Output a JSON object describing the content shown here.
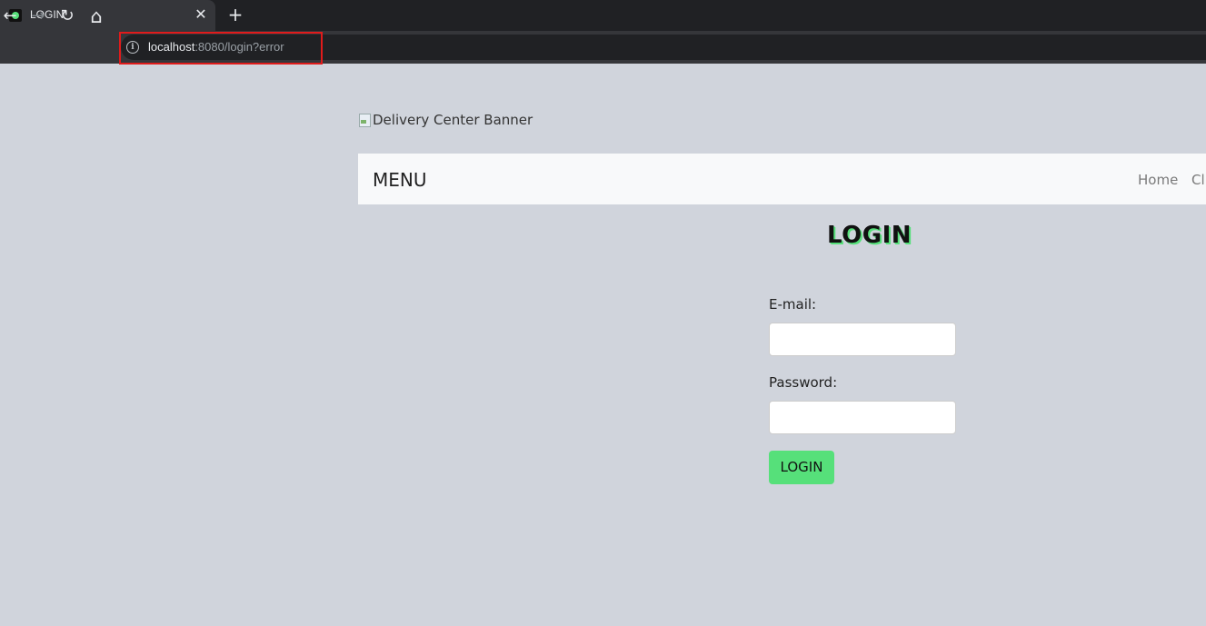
{
  "browser": {
    "tab_title": "LOGIN",
    "tab_close": "✕",
    "new_tab": "+",
    "url_host": "localhost",
    "url_rest": ":8080/login?error",
    "info_glyph": "i",
    "back_glyph": "←",
    "forward_glyph": "→",
    "reload_glyph": "↻",
    "home_glyph": "⌂",
    "highlight_color": "#e01b1b"
  },
  "page": {
    "banner_alt": "Delivery Center Banner",
    "navbar": {
      "brand": "MENU",
      "links": [
        "Home",
        "Cli"
      ]
    },
    "title": "LOGIN",
    "form": {
      "email_label": "E-mail:",
      "email_value": "",
      "password_label": "Password:",
      "password_value": "",
      "submit_label": "LOGIN"
    },
    "accent_color": "#56e07a"
  }
}
